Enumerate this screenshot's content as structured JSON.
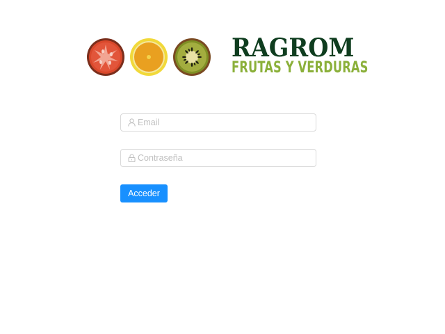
{
  "brand": {
    "name": "RAGROM",
    "tagline": "FRUTAS Y VERDURAS",
    "colors": {
      "name": "#0f3d1f",
      "tagline": "#8bb03a"
    }
  },
  "logo_fruits": [
    {
      "icon": "tomato-slice-icon",
      "color": "#d9482b"
    },
    {
      "icon": "orange-slice-icon",
      "color": "#e9a020"
    },
    {
      "icon": "kiwi-slice-icon",
      "color": "#8a9a2a"
    }
  ],
  "login": {
    "email": {
      "placeholder": "Email",
      "value": "",
      "icon": "user-icon"
    },
    "password": {
      "placeholder": "Contraseña",
      "value": "",
      "icon": "lock-icon"
    },
    "submit_label": "Acceder",
    "accent_color": "#1890ff"
  }
}
